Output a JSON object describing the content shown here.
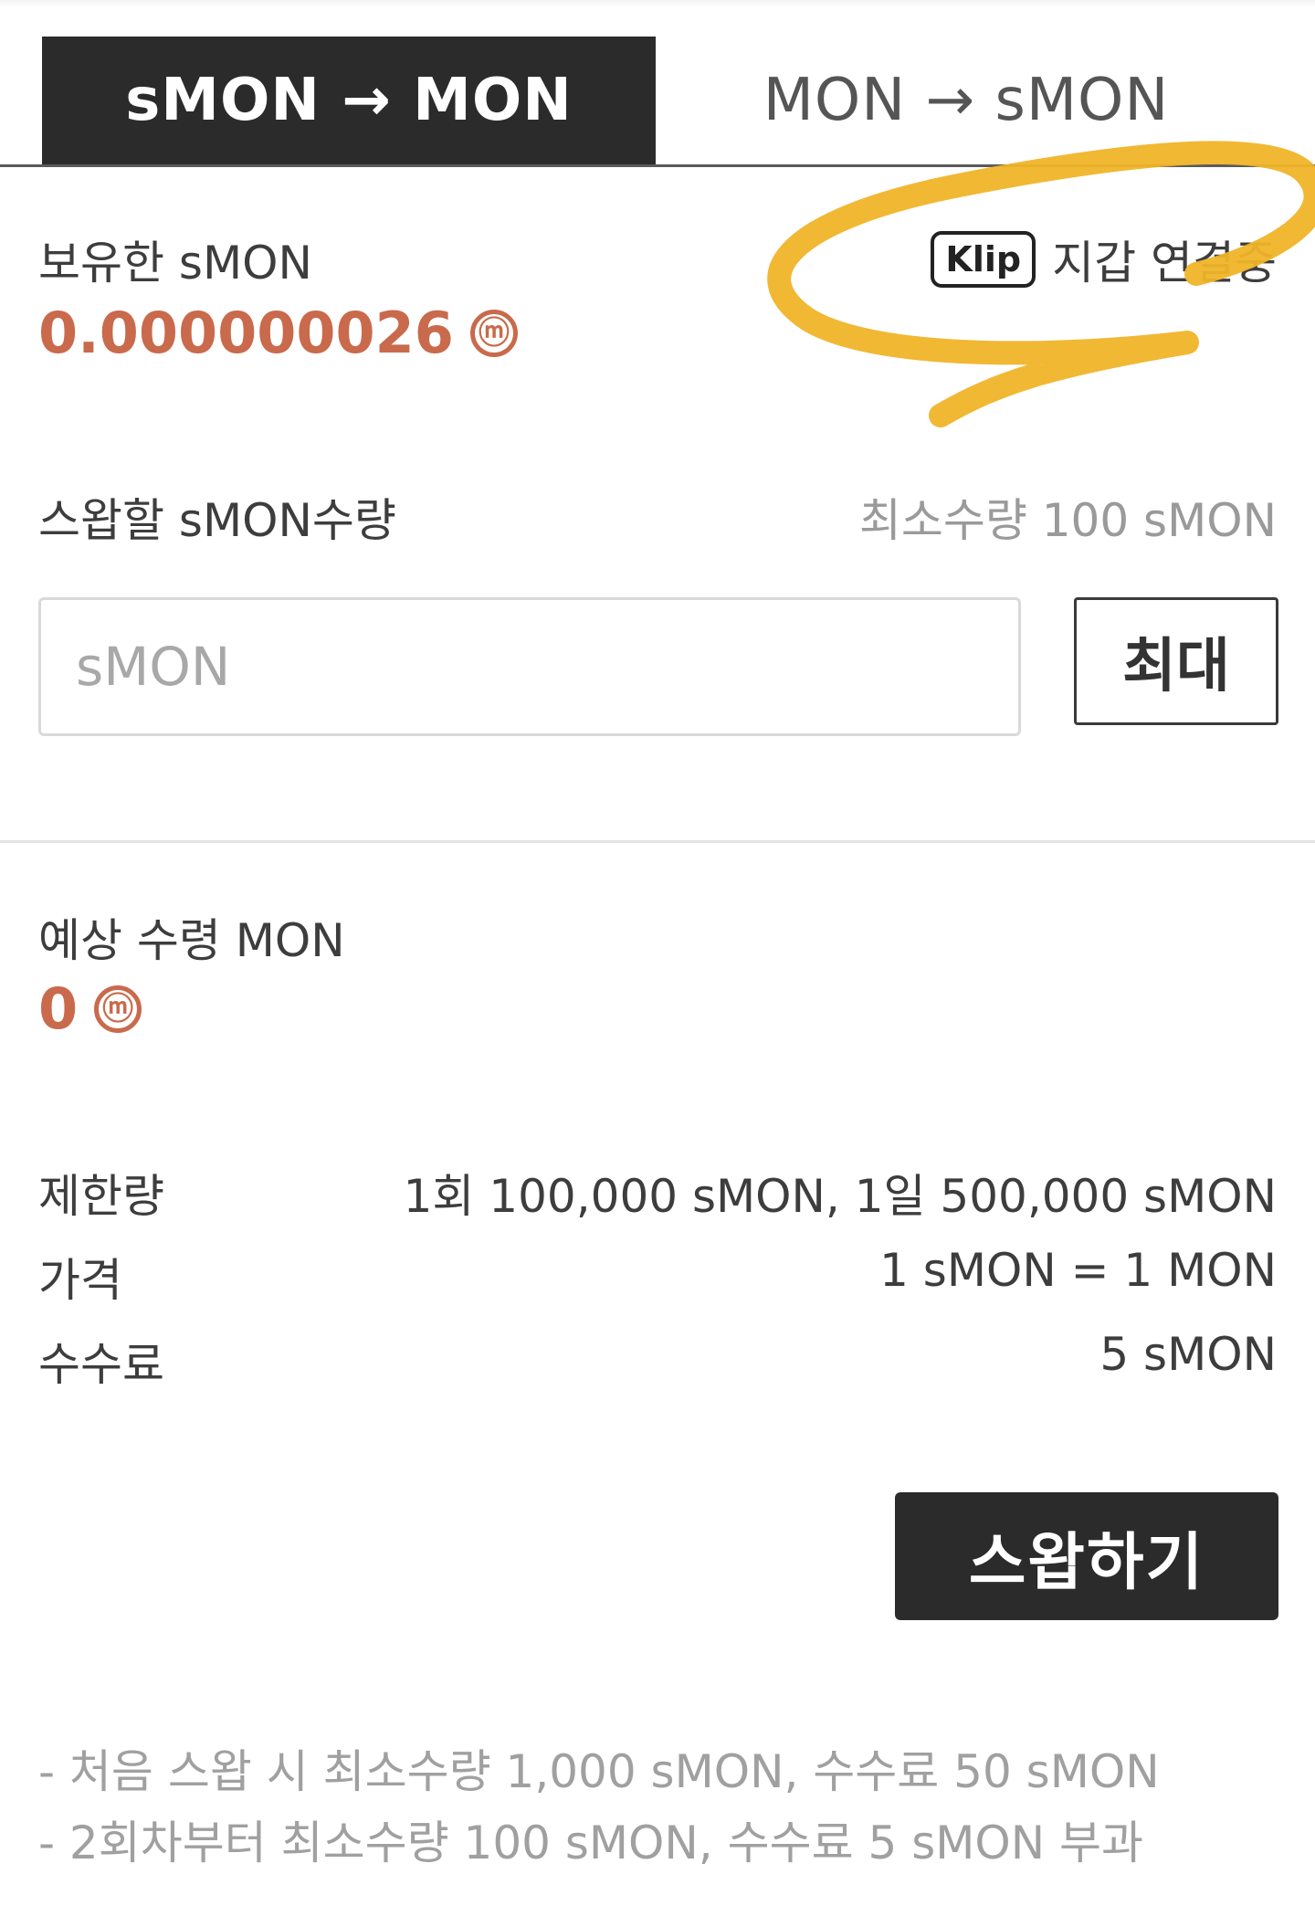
{
  "tabs": [
    {
      "label": "sMON → MON",
      "active": true
    },
    {
      "label": "MON → sMON",
      "active": false
    }
  ],
  "balance": {
    "label": "보유한 sMON",
    "value": "0.000000026",
    "coin_symbol": "ⓜ"
  },
  "wallet": {
    "badge": "Klip",
    "status": "지갑 연결중"
  },
  "swap_qty": {
    "label": "스왑할 sMON수량",
    "minimum": "최소수량 100 sMON",
    "input_placeholder": "sMON",
    "max_label": "최대"
  },
  "expected": {
    "label": "예상 수령 MON",
    "value": "0",
    "coin_symbol": "ⓜ"
  },
  "info": [
    {
      "label": "제한량",
      "value": "1회 100,000 sMON, 1일 500,000 sMON"
    },
    {
      "label": "가격",
      "value": "1 sMON = 1 MON"
    },
    {
      "label": "수수료",
      "value": "5 sMON"
    }
  ],
  "swap_button": "스왑하기",
  "notes": [
    "- 처음 스왑 시 최소수량 1,000 sMON, 수수료 50 sMON",
    "- 2회차부터 최소수량 100 sMON, 수수료 5 sMON 부과"
  ],
  "colors": {
    "accent": "#c96a4c",
    "dark": "#2b2b2b",
    "highlight_marker": "#f0b429"
  }
}
